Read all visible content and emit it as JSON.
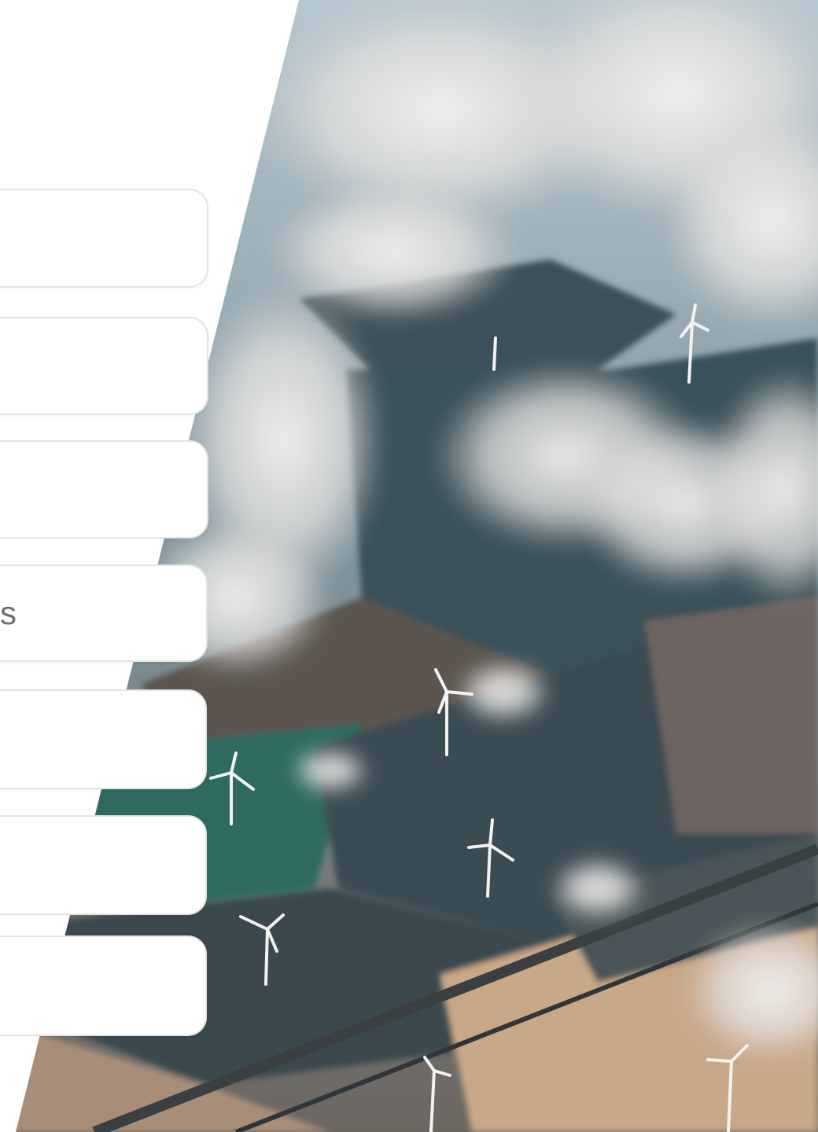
{
  "background": {
    "image": "aerial-landscape-clouds-wind-turbines",
    "colors": {
      "sky_haze": "#9fb3bf",
      "cloud": "#e6e4e2",
      "field_dark": "#3e5560",
      "field_teal": "#2f6a63",
      "field_brown": "#6e625b",
      "field_tan": "#c8a78a",
      "panel": "#ffffff"
    }
  },
  "options": [
    {
      "label": ""
    },
    {
      "label": ""
    },
    {
      "label": ""
    },
    {
      "label": "s"
    },
    {
      "label": ""
    },
    {
      "label": ""
    },
    {
      "label": ""
    }
  ],
  "colors": {
    "option_border": "#e4e4e4",
    "option_text": "#6f6f6f"
  }
}
